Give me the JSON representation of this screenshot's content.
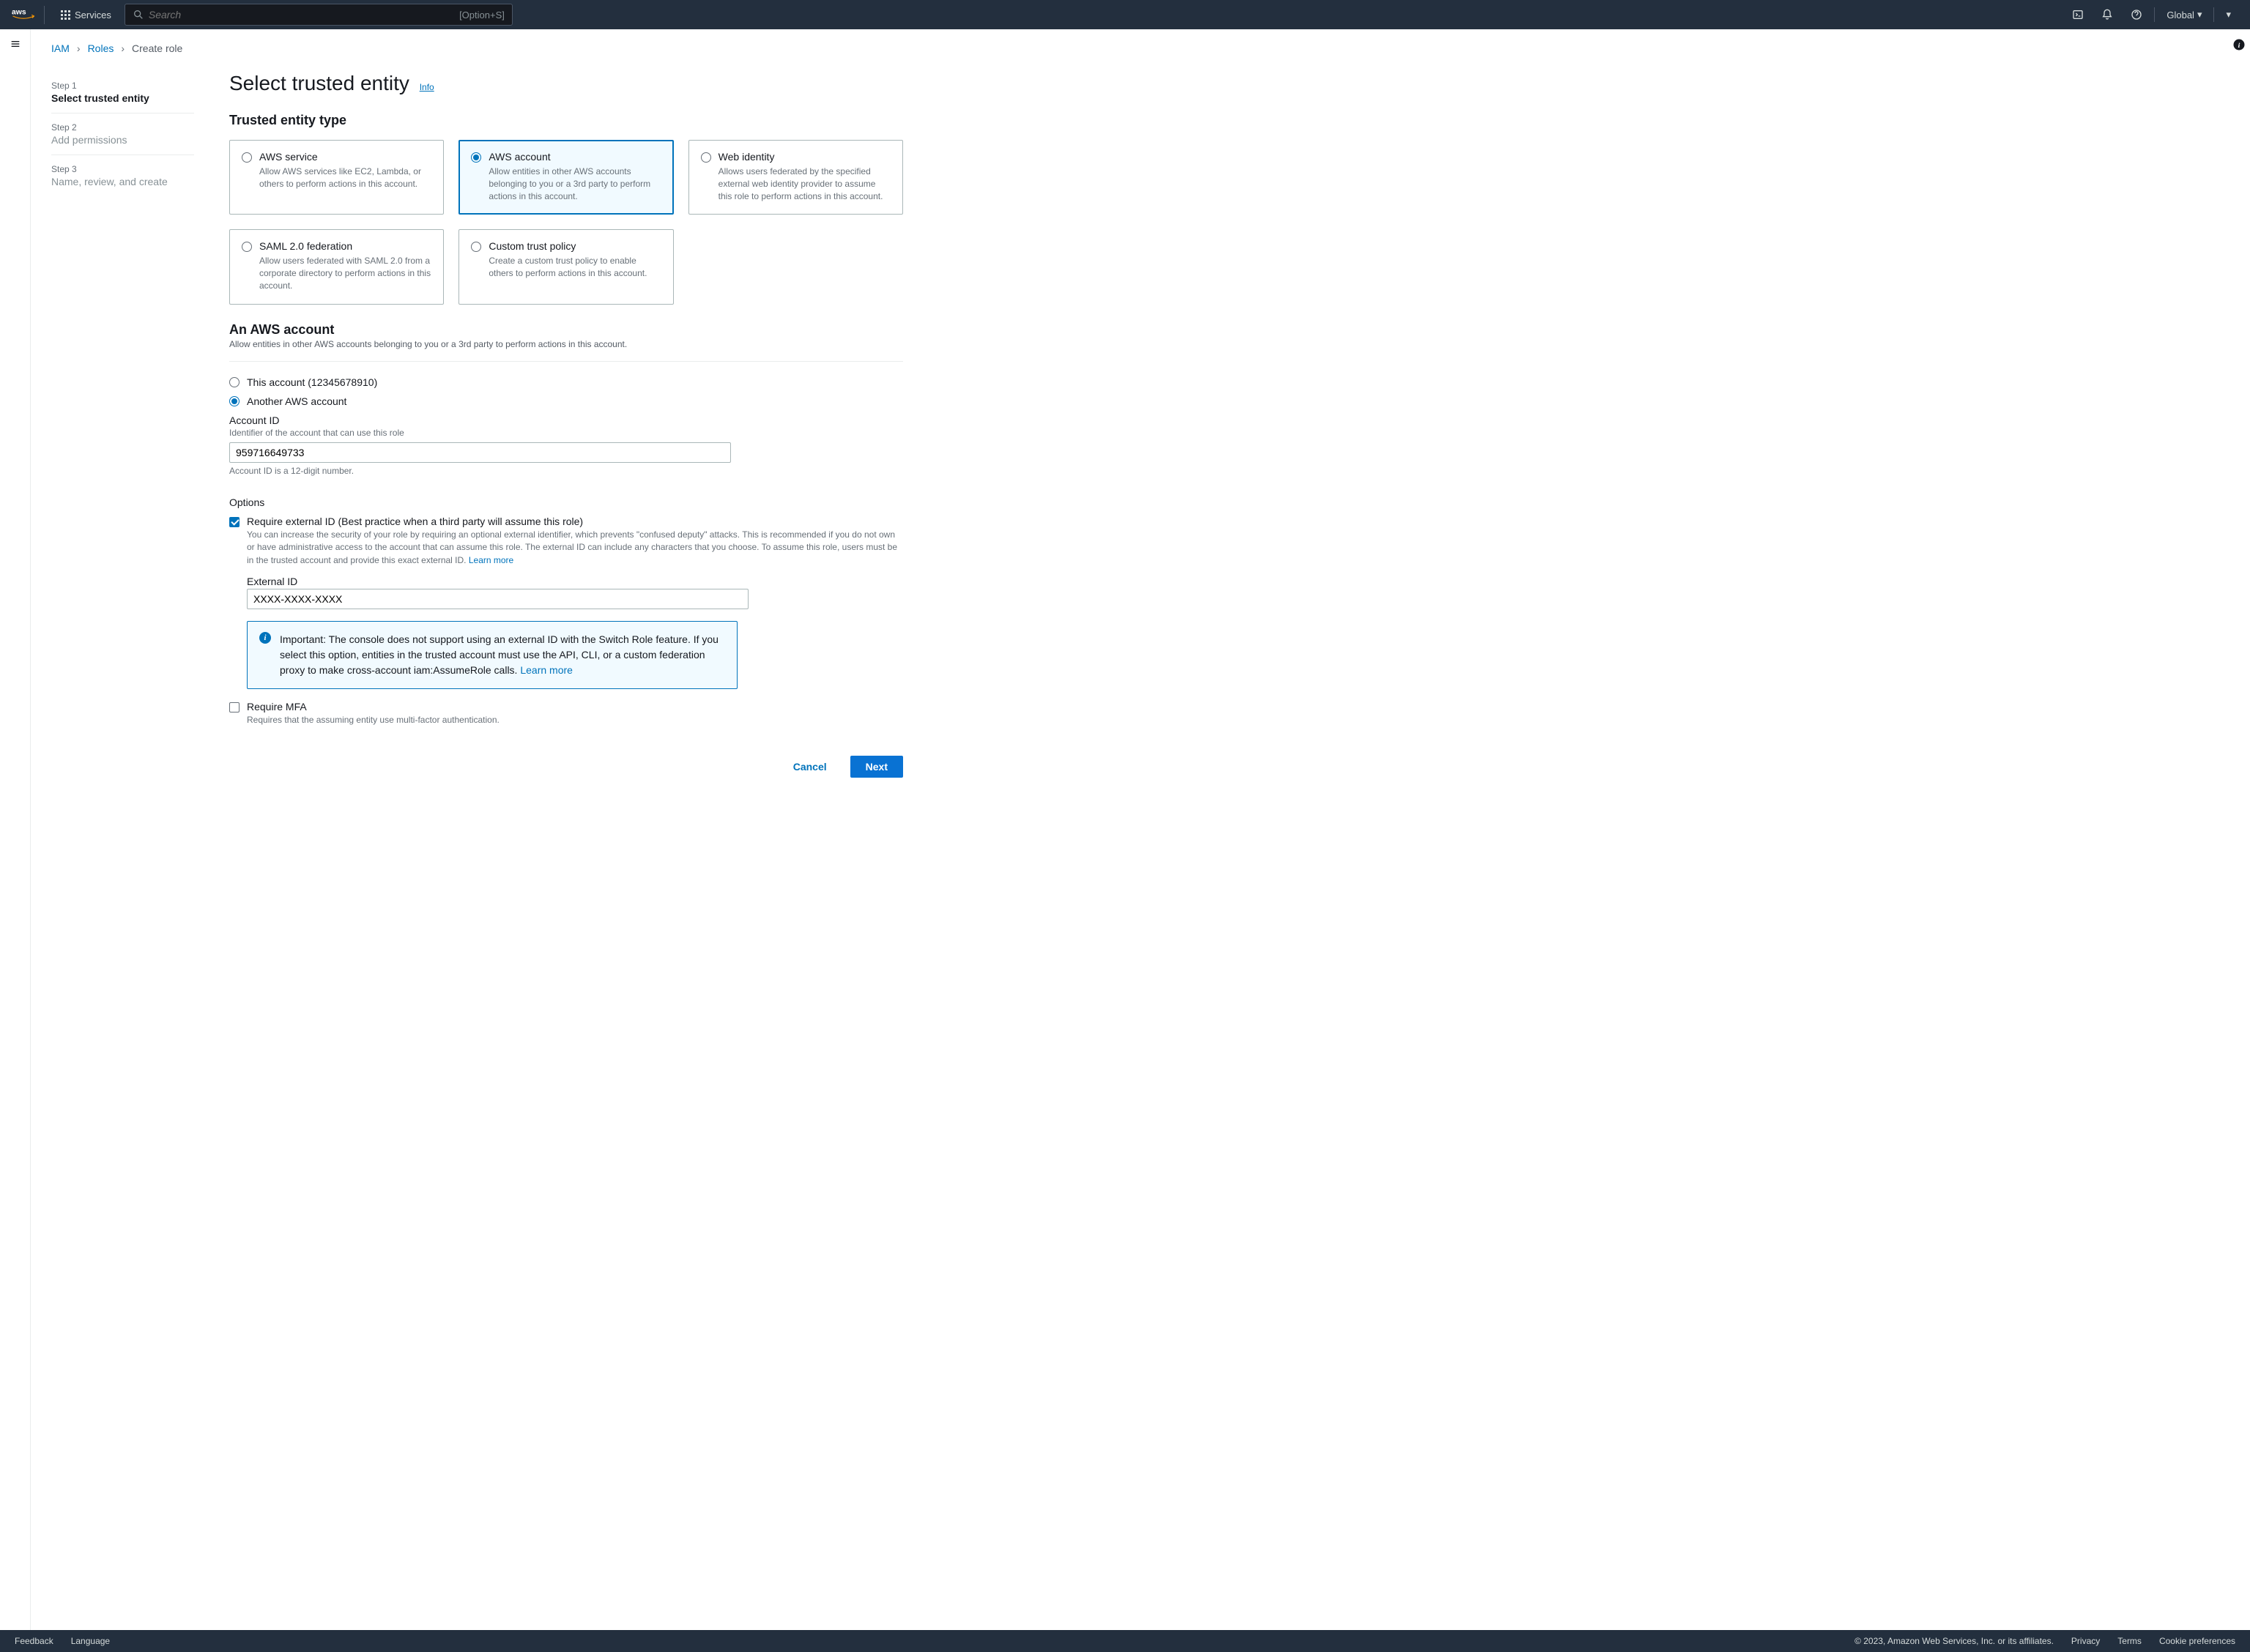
{
  "nav": {
    "services": "Services",
    "search_placeholder": "Search",
    "search_shortcut": "[Option+S]",
    "region": "Global"
  },
  "breadcrumb": {
    "iam": "IAM",
    "roles": "Roles",
    "current": "Create role"
  },
  "steps": [
    {
      "num": "Step 1",
      "title": "Select trusted entity",
      "state": "active"
    },
    {
      "num": "Step 2",
      "title": "Add permissions",
      "state": "muted"
    },
    {
      "num": "Step 3",
      "title": "Name, review, and create",
      "state": "muted"
    }
  ],
  "page": {
    "title": "Select trusted entity",
    "info": "Info"
  },
  "entity_section": {
    "heading": "Trusted entity type",
    "cards": [
      {
        "title": "AWS service",
        "desc": "Allow AWS services like EC2, Lambda, or others to perform actions in this account.",
        "selected": false
      },
      {
        "title": "AWS account",
        "desc": "Allow entities in other AWS accounts belonging to you or a 3rd party to perform actions in this account.",
        "selected": true
      },
      {
        "title": "Web identity",
        "desc": "Allows users federated by the specified external web identity provider to assume this role to perform actions in this account.",
        "selected": false
      },
      {
        "title": "SAML 2.0 federation",
        "desc": "Allow users federated with SAML 2.0 from a corporate directory to perform actions in this account.",
        "selected": false
      },
      {
        "title": "Custom trust policy",
        "desc": "Create a custom trust policy to enable others to perform actions in this account.",
        "selected": false
      }
    ]
  },
  "account_section": {
    "heading": "An AWS account",
    "desc": "Allow entities in other AWS accounts belonging to you or a 3rd party to perform actions in this account.",
    "this_account_label": "This account (12345678910)",
    "another_account_label": "Another AWS account",
    "selected": "another",
    "account_id_label": "Account ID",
    "account_id_hint": "Identifier of the account that can use this role",
    "account_id_value": "959716649733",
    "account_id_help": "Account ID is a 12-digit number."
  },
  "options": {
    "heading": "Options",
    "ext_id_label": "Require external ID (Best practice when a third party will assume this role)",
    "ext_id_desc": "You can increase the security of your role by requiring an optional external identifier, which prevents \"confused deputy\" attacks. This is recommended if you do not own or have administrative access to the account that can assume this role. The external ID can include any characters that you choose. To assume this role, users must be in the trusted account and provide this exact external ID. ",
    "learn_more": "Learn more",
    "ext_id_checked": true,
    "ext_id_field_label": "External ID",
    "ext_id_value": "XXXX-XXXX-XXXX",
    "mfa_label": "Require MFA",
    "mfa_desc": "Requires that the assuming entity use multi-factor authentication.",
    "mfa_checked": false
  },
  "alert": {
    "text": "Important: The console does not support using an external ID with the Switch Role feature. If you select this option, entities in the trusted account must use the API, CLI, or a custom federation proxy to make cross-account iam:AssumeRole calls. ",
    "learn_more": "Learn more"
  },
  "buttons": {
    "cancel": "Cancel",
    "next": "Next"
  },
  "footer": {
    "feedback": "Feedback",
    "language": "Language",
    "copyright": "© 2023, Amazon Web Services, Inc. or its affiliates.",
    "privacy": "Privacy",
    "terms": "Terms",
    "cookies": "Cookie preferences"
  }
}
